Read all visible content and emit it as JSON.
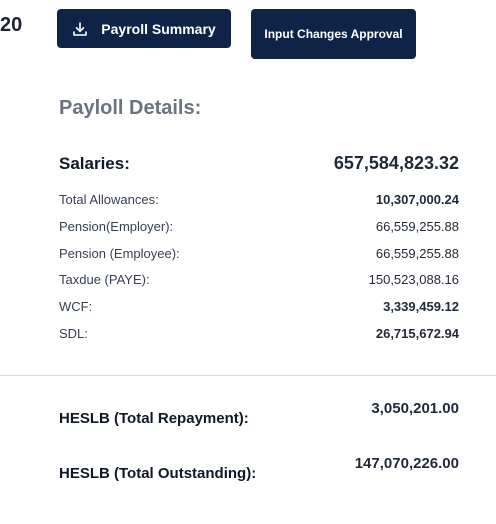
{
  "header": {
    "fragment_number": "20",
    "payroll_summary_label": "Payroll Summary",
    "input_changes_label": "Input Changes Approval"
  },
  "details": {
    "title": "Payloll Details:",
    "salaries_label": "Salaries:",
    "salaries_value": "657,584,823.32",
    "items": [
      {
        "label": "Total Allowances:",
        "value": "10,307,000.24"
      },
      {
        "label": "Pension(Employer):",
        "value": "66,559,255.88"
      },
      {
        "label": "Pension (Employee):",
        "value": "66,559,255.88"
      },
      {
        "label": "Taxdue (PAYE):",
        "value": "150,523,088.16"
      },
      {
        "label": "WCF:",
        "value": "3,339,459.12"
      },
      {
        "label": "SDL:",
        "value": "26,715,672.94"
      }
    ]
  },
  "heslb": {
    "repayment_label": "HESLB (Total Repayment):",
    "repayment_value": "3,050,201.00",
    "outstanding_label": "HESLB (Total Outstanding):",
    "outstanding_value": "147,070,226.00"
  },
  "icons": {
    "download": "download-icon"
  },
  "colors": {
    "button_bg": "#0f2347",
    "button_text": "#ffffff",
    "title_gray": "#6b7280"
  }
}
